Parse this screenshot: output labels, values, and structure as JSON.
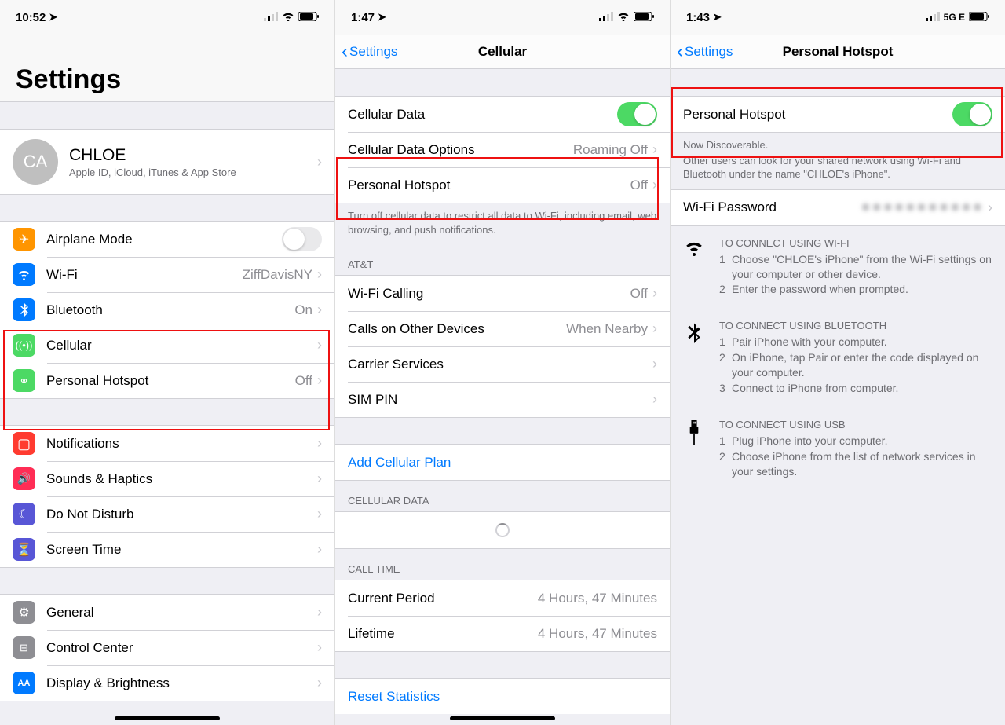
{
  "p1": {
    "time": "10:52",
    "title": "Settings",
    "profile": {
      "initials": "CA",
      "name": "CHLOE",
      "sub": "Apple ID, iCloud, iTunes & App Store"
    },
    "airplane": "Airplane Mode",
    "wifi": {
      "label": "Wi-Fi",
      "value": "ZiffDavisNY"
    },
    "bluetooth": {
      "label": "Bluetooth",
      "value": "On"
    },
    "cellular": "Cellular",
    "hotspot": {
      "label": "Personal Hotspot",
      "value": "Off"
    },
    "notifications": "Notifications",
    "sounds": "Sounds & Haptics",
    "dnd": "Do Not Disturb",
    "screentime": "Screen Time",
    "general": "General",
    "control": "Control Center",
    "display": "Display & Brightness"
  },
  "p2": {
    "time": "1:47",
    "back": "Settings",
    "title": "Cellular",
    "cellular_data": "Cellular Data",
    "options": {
      "label": "Cellular Data Options",
      "value": "Roaming Off"
    },
    "hotspot": {
      "label": "Personal Hotspot",
      "value": "Off"
    },
    "foot1": "Turn off cellular data to restrict all data to Wi-Fi, including email, web browsing, and push notifications.",
    "carrier_header": "AT&T",
    "wifi_calling": {
      "label": "Wi-Fi Calling",
      "value": "Off"
    },
    "calls_other": {
      "label": "Calls on Other Devices",
      "value": "When Nearby"
    },
    "carrier_services": "Carrier Services",
    "sim_pin": "SIM PIN",
    "add_plan": "Add Cellular Plan",
    "data_header": "CELLULAR DATA",
    "call_header": "CALL TIME",
    "current": {
      "label": "Current Period",
      "value": "4 Hours, 47 Minutes"
    },
    "lifetime": {
      "label": "Lifetime",
      "value": "4 Hours, 47 Minutes"
    },
    "reset": "Reset Statistics"
  },
  "p3": {
    "time": "1:43",
    "signal": "5G E",
    "back": "Settings",
    "title": "Personal Hotspot",
    "hotspot": "Personal Hotspot",
    "discoverable": "Now Discoverable.",
    "discover_note": "Other users can look for your shared network using Wi-Fi and Bluetooth under the name \"CHLOE's iPhone\".",
    "wifi_pw": "Wi-Fi Password",
    "inst_wifi_title": "TO CONNECT USING WI-FI",
    "inst_wifi_1": "Choose \"CHLOE's iPhone\" from the Wi-Fi settings on your computer or other device.",
    "inst_wifi_2": "Enter the password when prompted.",
    "inst_bt_title": "TO CONNECT USING BLUETOOTH",
    "inst_bt_1": "Pair iPhone with your computer.",
    "inst_bt_2": "On iPhone, tap Pair or enter the code displayed on your computer.",
    "inst_bt_3": "Connect to iPhone from computer.",
    "inst_usb_title": "TO CONNECT USING USB",
    "inst_usb_1": "Plug iPhone into your computer.",
    "inst_usb_2": "Choose iPhone from the list of network services in your settings."
  }
}
